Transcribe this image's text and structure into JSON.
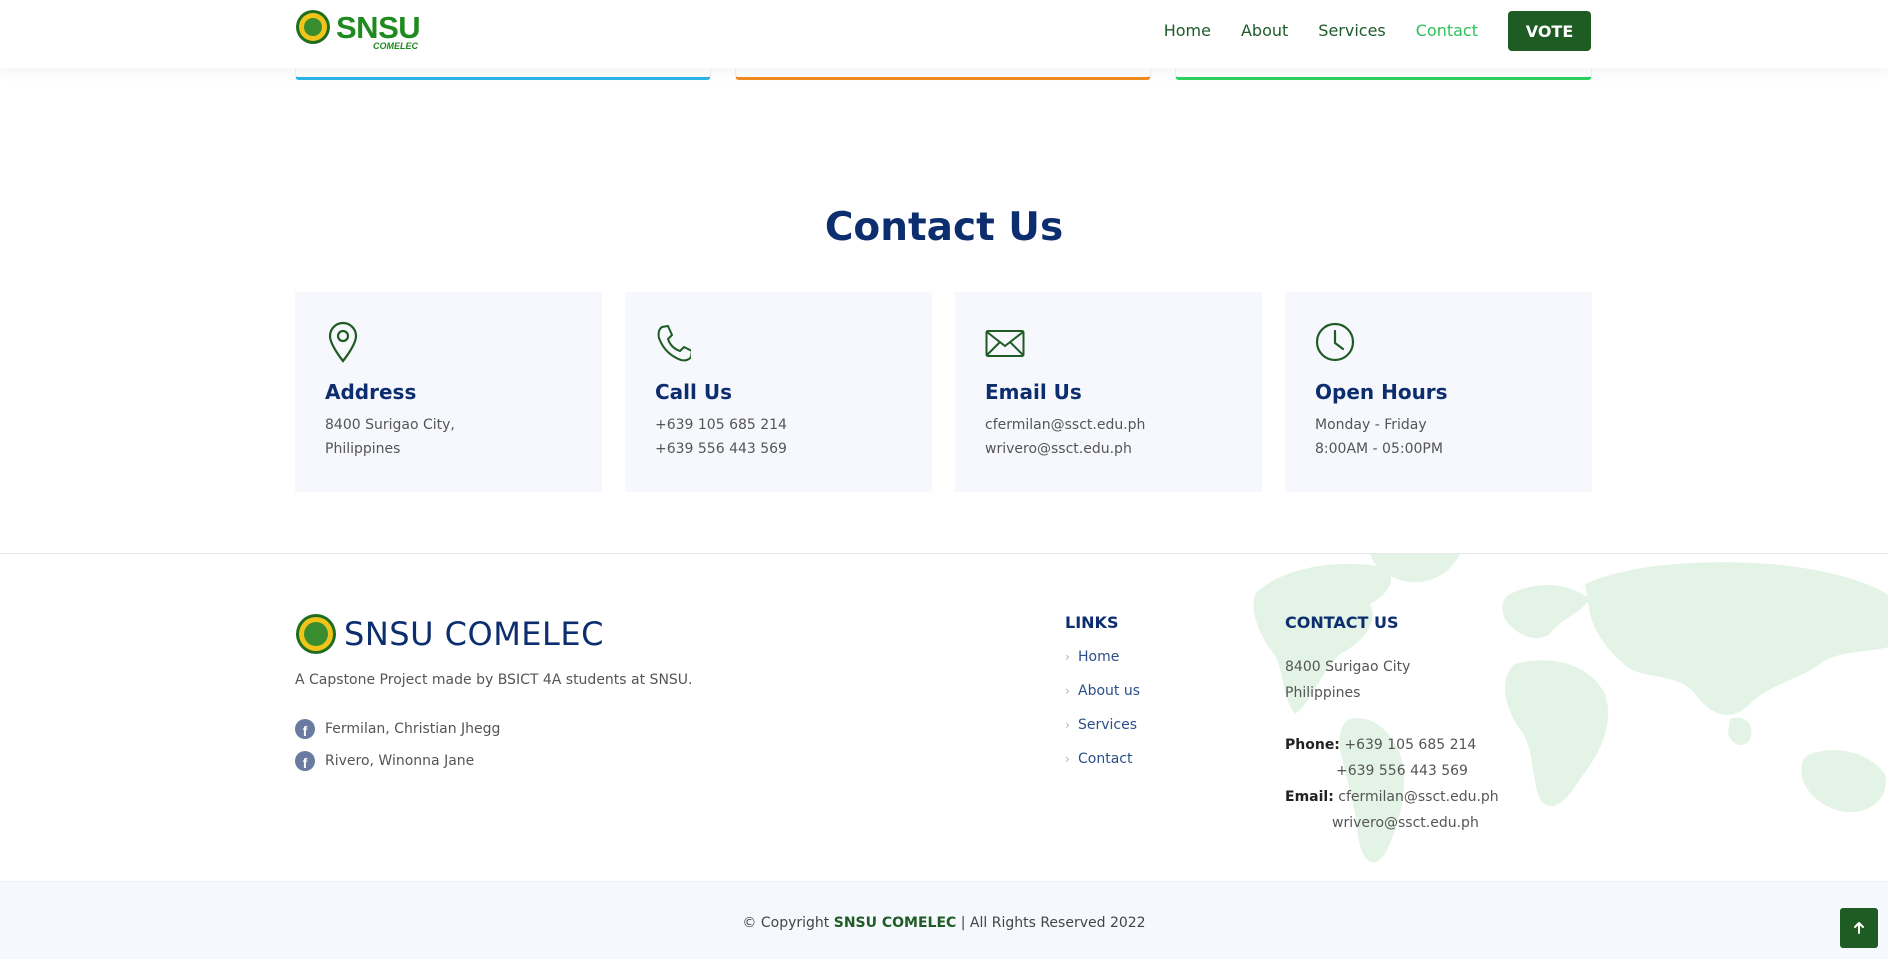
{
  "header": {
    "logo_main": "SNSU",
    "logo_sub": "COMELEC",
    "nav": [
      "Home",
      "About",
      "Services",
      "Contact"
    ],
    "active_nav": "Contact",
    "vote_label": "VOTE"
  },
  "top_cards": {
    "accent_colors": [
      "#2bb5ea",
      "#f28c1f",
      "#2ed160"
    ]
  },
  "contact": {
    "title": "Contact Us",
    "boxes": [
      {
        "icon": "map-pin-icon",
        "title": "Address",
        "lines": [
          "8400 Surigao City,",
          "Philippines"
        ]
      },
      {
        "icon": "phone-icon",
        "title": "Call Us",
        "lines": [
          "+639 105 685 214",
          "+639 556 443 569"
        ]
      },
      {
        "icon": "envelope-icon",
        "title": "Email Us",
        "lines": [
          "cfermilan@ssct.edu.ph",
          "wrivero@ssct.edu.ph"
        ]
      },
      {
        "icon": "clock-icon",
        "title": "Open Hours",
        "lines": [
          "Monday - Friday",
          "8:00AM - 05:00PM"
        ]
      }
    ]
  },
  "footer": {
    "brand": "SNSU COMELEC",
    "description": "A Capstone Project made by BSICT 4A students at SNSU.",
    "social": [
      "Fermilan, Christian Jhegg",
      "Rivero, Winonna Jane"
    ],
    "links_heading": "LINKS",
    "links": [
      "Home",
      "About us",
      "Services",
      "Contact"
    ],
    "contact_heading": "CONTACT US",
    "address_lines": [
      "8400 Surigao City",
      "Philippines"
    ],
    "phone_label": "Phone:",
    "phones": [
      "+639 105 685 214",
      "+639 556 443 569"
    ],
    "email_label": "Email:",
    "emails": [
      "cfermilan@ssct.edu.ph",
      "wrivero@ssct.edu.ph"
    ]
  },
  "copyright": {
    "prefix": "© Copyright",
    "brand": "SNSU COMELEC",
    "suffix": "| All Rights Reserved 2022"
  },
  "colors": {
    "brand_green": "#1f5c24",
    "navy": "#0d2e6e",
    "active_link": "#2ec05b"
  }
}
